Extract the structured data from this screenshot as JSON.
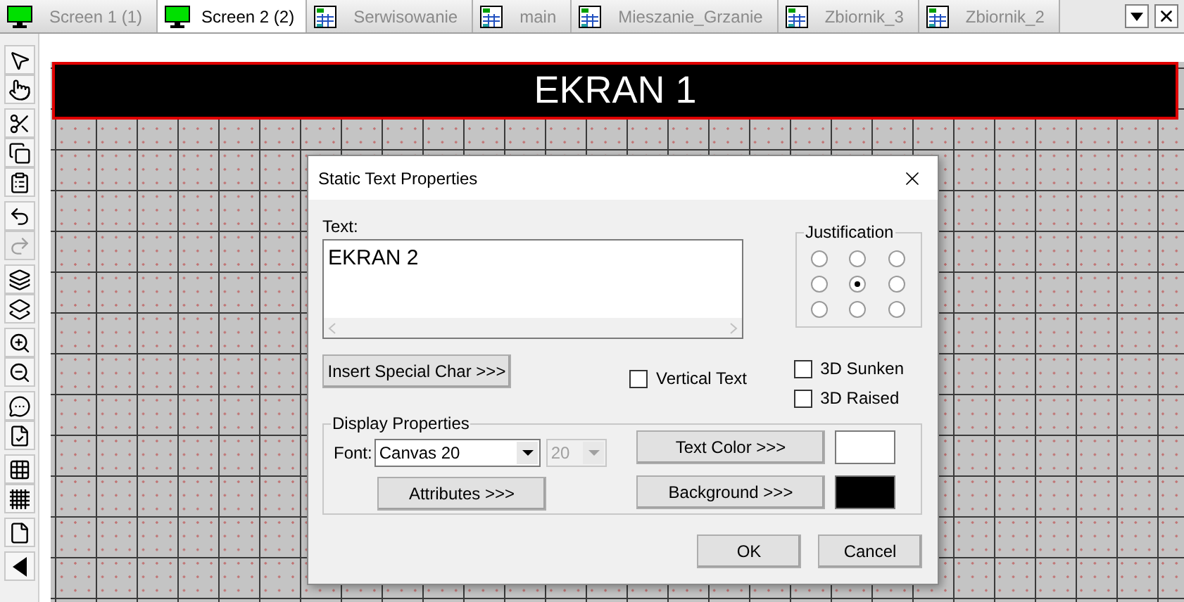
{
  "tabs": [
    {
      "label": "Screen 1 (1)",
      "kind": "screen",
      "selected": false
    },
    {
      "label": "Screen 2 (2)",
      "kind": "screen",
      "selected": true
    },
    {
      "label": "Serwisowanie",
      "kind": "sheet",
      "selected": false
    },
    {
      "label": "main",
      "kind": "sheet",
      "selected": false
    },
    {
      "label": "Mieszanie_Grzanie",
      "kind": "sheet",
      "selected": false
    },
    {
      "label": "Zbiornik_3",
      "kind": "sheet",
      "selected": false
    },
    {
      "label": "Zbiornik_2",
      "kind": "sheet",
      "selected": false
    }
  ],
  "toolbar_groups": [
    [
      {
        "kind": "pointer",
        "disabled": false
      },
      {
        "kind": "hand",
        "disabled": false
      }
    ],
    [
      {
        "kind": "cut",
        "disabled": false
      },
      {
        "kind": "copy",
        "disabled": false
      },
      {
        "kind": "paste",
        "disabled": false
      }
    ],
    [
      {
        "kind": "undo",
        "disabled": false
      },
      {
        "kind": "redo",
        "disabled": true
      }
    ],
    [
      {
        "kind": "front",
        "disabled": false
      },
      {
        "kind": "back",
        "disabled": false
      }
    ],
    [
      {
        "kind": "zoom_in",
        "disabled": false
      },
      {
        "kind": "zoom_out",
        "disabled": false
      }
    ],
    [
      {
        "kind": "comment",
        "disabled": false
      },
      {
        "kind": "check",
        "disabled": false
      }
    ],
    [
      {
        "kind": "grid",
        "disabled": false
      },
      {
        "kind": "fine_grid",
        "disabled": false
      }
    ],
    [
      {
        "kind": "page",
        "disabled": false
      }
    ],
    [
      {
        "kind": "collapse",
        "disabled": false
      }
    ]
  ],
  "canvas": {
    "header": "EKRAN 1"
  },
  "dialog": {
    "title": "Static Text Properties",
    "text_label": "Text:",
    "text_value": "EKRAN 2",
    "justification": {
      "label": "Justification",
      "options": [
        {
          "selected": false
        },
        {
          "selected": false
        },
        {
          "selected": false
        },
        {
          "selected": false
        },
        {
          "selected": true
        },
        {
          "selected": false
        },
        {
          "selected": false
        },
        {
          "selected": false
        },
        {
          "selected": false
        }
      ]
    },
    "insert_button": "Insert Special Char >>>",
    "vertical_text": {
      "label": "Vertical Text",
      "checked": false
    },
    "sunken": {
      "label": "3D Sunken",
      "checked": false
    },
    "raised": {
      "label": "3D Raised",
      "checked": false
    },
    "display": {
      "label": "Display Properties",
      "font_label": "Font:",
      "font_value": "Canvas 20",
      "size_value": "20",
      "size_disabled": true,
      "attributes_button": "Attributes >>>",
      "text_color_button": "Text Color >>>",
      "text_swatch": {
        "color": "#ffffff"
      },
      "background_button": "Background >>>",
      "background_swatch": {
        "color": "#000000"
      }
    },
    "ok": "OK",
    "cancel": "Cancel"
  }
}
